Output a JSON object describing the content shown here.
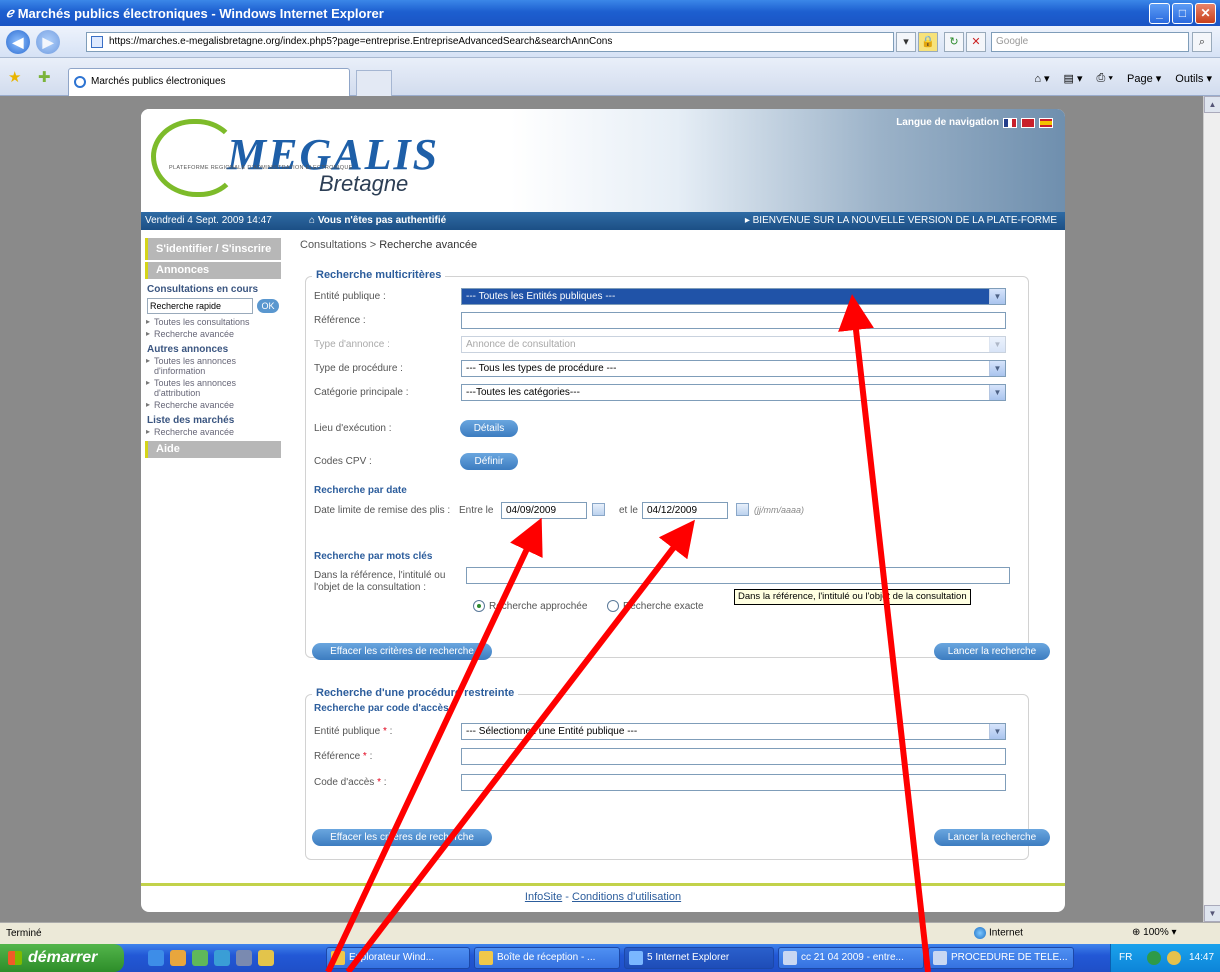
{
  "window": {
    "title": "Marchés publics électroniques - Windows Internet Explorer",
    "controls": [
      "_",
      "□",
      "✕"
    ]
  },
  "browser": {
    "url": "https://marches.e-megalisbretagne.org/index.php5?page=entreprise.EntrepriseAdvancedSearch&searchAnnCons",
    "search_placeholder": "Google",
    "tab_title": "Marchés publics électroniques",
    "commands": [
      "Page ▾",
      "Outils ▾"
    ]
  },
  "banner": {
    "brand": "MEGALIS",
    "subtitle": "PLATEFORME REGIONALE D'ADMINISTRATION ELECTRONIQUE",
    "region": "Bretagne",
    "language_label": "Langue de navigation"
  },
  "infobar": {
    "date": "Vendredi 4 Sept. 2009 14:47",
    "auth": "Vous n'êtes pas authentifié",
    "welcome": "BIENVENUE SUR LA NOUVELLE VERSION DE LA PLATE-FORME"
  },
  "sidebar": {
    "login": "S'identifier / S'inscrire",
    "annonces": "Annonces",
    "consultations_title": "Consultations en cours",
    "quick_search_value": "Recherche rapide",
    "ok": "OK",
    "consultations_links": [
      "Toutes les consultations",
      "Recherche avancée"
    ],
    "autres_title": "Autres annonces",
    "autres_links": [
      "Toutes les annonces d'information",
      "Toutes les annonces d'attribution",
      "Recherche avancée"
    ],
    "marches_title": "Liste des marchés",
    "marches_links": [
      "Recherche avancée"
    ],
    "aide": "Aide"
  },
  "breadcrumb": {
    "root": "Consultations",
    "sep": ">",
    "current": "Recherche avancée"
  },
  "multi": {
    "legend": "Recherche multicritères",
    "entite_label": "Entité publique :",
    "entite_value": "--- Toutes les Entités publiques ---",
    "reference_label": "Référence :",
    "type_annonce_label": "Type d'annonce :",
    "type_annonce_value": "Annonce de consultation",
    "type_procedure_label": "Type de procédure :",
    "type_procedure_value": "--- Tous les types de procédure ---",
    "categorie_label": "Catégorie principale :",
    "categorie_value": "---Toutes les catégories---",
    "lieu_label": "Lieu d'exécution :",
    "details_btn": "Détails",
    "cpv_label": "Codes CPV :",
    "definir_btn": "Définir",
    "date_section": "Recherche par date",
    "date_label": "Date limite de remise des plis :",
    "entre_le": "Entre le",
    "date_from": "04/09/2009",
    "et_le": "et le",
    "date_to": "04/12/2009",
    "date_format": "(jj/mm/aaaa)",
    "keywords_section": "Recherche par mots clés",
    "keywords_label_1": "Dans la référence, l'intitulé ou",
    "keywords_label_2": "l'objet de la consultation :",
    "radio_approx": "Recherche approchée",
    "radio_exact": "Recherche exacte",
    "tooltip": "Dans la référence, l'intitulé ou l'objet de la consultation",
    "clear_btn": "Effacer les critères de recherche",
    "search_btn": "Lancer la recherche"
  },
  "restricted": {
    "legend": "Recherche d'une procédure restreinte",
    "section": "Recherche par code d'accès",
    "entite_label": "Entité publique",
    "entite_value": "--- Sélectionnez une Entité publique ---",
    "reference_label": "Référence",
    "code_label": "Code d'accès",
    "req": "*",
    "colon": " :",
    "clear_btn": "Effacer les critères de recherche",
    "search_btn": "Lancer la recherche"
  },
  "footer": {
    "infosite": "InfoSite",
    "sep": "-",
    "conditions": "Conditions d'utilisation"
  },
  "statusbar": {
    "status": "Terminé",
    "zone": "Internet",
    "zoom": "100%"
  },
  "taskbar": {
    "start": "démarrer",
    "tasks": [
      "Explorateur Wind...",
      "Boîte de réception - ...",
      "5 Internet Explorer",
      "cc 21 04 2009 - entre...",
      "PROCEDURE DE TELE..."
    ],
    "lang": "FR",
    "clock": "14:47"
  },
  "colors": {
    "brand_blue": "#1e5fa8",
    "brand_green": "#7dbb2a",
    "annotation_red": "#ff0000"
  }
}
